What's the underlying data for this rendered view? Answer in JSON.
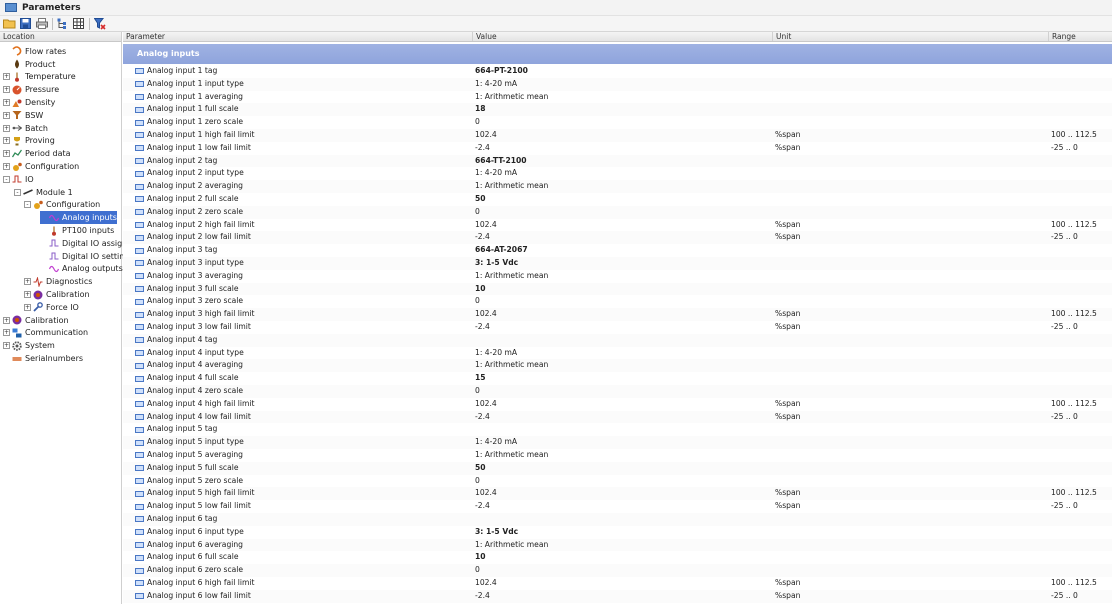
{
  "window": {
    "title": "Parameters"
  },
  "toolbar": {
    "buttons": [
      "open-folder-icon",
      "save-icon",
      "print-icon",
      "tree-view-icon",
      "grid-view-icon",
      "filter-icon"
    ]
  },
  "tree": {
    "header": "Location",
    "nodes": [
      {
        "label": "Flow rates",
        "level": 0,
        "icon": "flow-icon",
        "expander": ""
      },
      {
        "label": "Product",
        "level": 0,
        "icon": "drop-icon",
        "expander": ""
      },
      {
        "label": "Temperature",
        "level": 0,
        "icon": "thermometer-icon",
        "expander": "+"
      },
      {
        "label": "Pressure",
        "level": 0,
        "icon": "gauge-icon",
        "expander": "+"
      },
      {
        "label": "Density",
        "level": 0,
        "icon": "density-icon",
        "expander": "+"
      },
      {
        "label": "BSW",
        "level": 0,
        "icon": "funnel-icon",
        "expander": "+"
      },
      {
        "label": "Batch",
        "level": 0,
        "icon": "batch-icon",
        "expander": "+"
      },
      {
        "label": "Proving",
        "level": 0,
        "icon": "trophy-icon",
        "expander": "+"
      },
      {
        "label": "Period data",
        "level": 0,
        "icon": "period-icon",
        "expander": "+"
      },
      {
        "label": "Configuration",
        "level": 0,
        "icon": "config-icon",
        "expander": "+"
      },
      {
        "label": "IO",
        "level": 0,
        "icon": "io-icon",
        "expander": "-"
      },
      {
        "label": "Module 1",
        "level": 1,
        "icon": "module-icon",
        "expander": "-"
      },
      {
        "label": "Configuration",
        "level": 2,
        "icon": "config-icon",
        "expander": "-"
      },
      {
        "label": "Analog inputs",
        "level": 3,
        "icon": "wave-icon",
        "expander": "",
        "selected": true
      },
      {
        "label": "PT100 inputs",
        "level": 3,
        "icon": "thermometer-icon",
        "expander": ""
      },
      {
        "label": "Digital IO assign",
        "level": 3,
        "icon": "digital-icon",
        "expander": ""
      },
      {
        "label": "Digital IO settings",
        "level": 3,
        "icon": "digital-icon",
        "expander": ""
      },
      {
        "label": "Analog outputs",
        "level": 3,
        "icon": "wave-icon",
        "expander": ""
      },
      {
        "label": "Diagnostics",
        "level": 2,
        "icon": "diagnostics-icon",
        "expander": "+"
      },
      {
        "label": "Calibration",
        "level": 2,
        "icon": "calibration-icon",
        "expander": "+"
      },
      {
        "label": "Force IO",
        "level": 2,
        "icon": "wrench-icon",
        "expander": "+"
      },
      {
        "label": "Calibration",
        "level": 0,
        "icon": "calibration-icon",
        "expander": "+"
      },
      {
        "label": "Communication",
        "level": 0,
        "icon": "network-icon",
        "expander": "+"
      },
      {
        "label": "System",
        "level": 0,
        "icon": "gear-icon",
        "expander": "+"
      },
      {
        "label": "Serialnumbers",
        "level": 0,
        "icon": "serial-icon",
        "expander": ""
      }
    ]
  },
  "grid": {
    "columns": [
      "Parameter",
      "Value",
      "Unit",
      "Range"
    ],
    "group": "Analog inputs",
    "rows": [
      {
        "p": "Analog input 1 tag",
        "v": "664-PT-2100",
        "b": true,
        "u": "",
        "r": ""
      },
      {
        "p": "Analog input 1 input type",
        "v": "1: 4-20 mA",
        "b": false,
        "u": "",
        "r": ""
      },
      {
        "p": "Analog input 1 averaging",
        "v": "1: Arithmetic mean",
        "b": false,
        "u": "",
        "r": ""
      },
      {
        "p": "Analog input 1 full scale",
        "v": "18",
        "b": true,
        "u": "",
        "r": ""
      },
      {
        "p": "Analog input 1 zero scale",
        "v": "0",
        "b": false,
        "u": "",
        "r": ""
      },
      {
        "p": "Analog input 1 high fail limit",
        "v": "102.4",
        "b": false,
        "u": "%span",
        "r": "100 .. 112.5"
      },
      {
        "p": "Analog input 1 low fail limit",
        "v": "-2.4",
        "b": false,
        "u": "%span",
        "r": "-25 .. 0"
      },
      {
        "p": "Analog input 2 tag",
        "v": "664-TT-2100",
        "b": true,
        "u": "",
        "r": ""
      },
      {
        "p": "Analog input 2 input type",
        "v": "1: 4-20 mA",
        "b": false,
        "u": "",
        "r": ""
      },
      {
        "p": "Analog input 2 averaging",
        "v": "1: Arithmetic mean",
        "b": false,
        "u": "",
        "r": ""
      },
      {
        "p": "Analog input 2 full scale",
        "v": "50",
        "b": true,
        "u": "",
        "r": ""
      },
      {
        "p": "Analog input 2 zero scale",
        "v": "0",
        "b": false,
        "u": "",
        "r": ""
      },
      {
        "p": "Analog input 2 high fail limit",
        "v": "102.4",
        "b": false,
        "u": "%span",
        "r": "100 .. 112.5"
      },
      {
        "p": "Analog input 2 low fail limit",
        "v": "-2.4",
        "b": false,
        "u": "%span",
        "r": "-25 .. 0"
      },
      {
        "p": "Analog input 3 tag",
        "v": "664-AT-2067",
        "b": true,
        "u": "",
        "r": ""
      },
      {
        "p": "Analog input 3 input type",
        "v": "3: 1-5 Vdc",
        "b": true,
        "u": "",
        "r": ""
      },
      {
        "p": "Analog input 3 averaging",
        "v": "1: Arithmetic mean",
        "b": false,
        "u": "",
        "r": ""
      },
      {
        "p": "Analog input 3 full scale",
        "v": "10",
        "b": true,
        "u": "",
        "r": ""
      },
      {
        "p": "Analog input 3 zero scale",
        "v": "0",
        "b": false,
        "u": "",
        "r": ""
      },
      {
        "p": "Analog input 3 high fail limit",
        "v": "102.4",
        "b": false,
        "u": "%span",
        "r": "100 .. 112.5"
      },
      {
        "p": "Analog input 3 low fail limit",
        "v": "-2.4",
        "b": false,
        "u": "%span",
        "r": "-25 .. 0"
      },
      {
        "p": "Analog input 4 tag",
        "v": "",
        "b": false,
        "u": "",
        "r": ""
      },
      {
        "p": "Analog input 4 input type",
        "v": "1: 4-20 mA",
        "b": false,
        "u": "",
        "r": ""
      },
      {
        "p": "Analog input 4 averaging",
        "v": "1: Arithmetic mean",
        "b": false,
        "u": "",
        "r": ""
      },
      {
        "p": "Analog input 4 full scale",
        "v": "15",
        "b": true,
        "u": "",
        "r": ""
      },
      {
        "p": "Analog input 4 zero scale",
        "v": "0",
        "b": false,
        "u": "",
        "r": ""
      },
      {
        "p": "Analog input 4 high fail limit",
        "v": "102.4",
        "b": false,
        "u": "%span",
        "r": "100 .. 112.5"
      },
      {
        "p": "Analog input 4 low fail limit",
        "v": "-2.4",
        "b": false,
        "u": "%span",
        "r": "-25 .. 0"
      },
      {
        "p": "Analog input 5 tag",
        "v": "",
        "b": false,
        "u": "",
        "r": ""
      },
      {
        "p": "Analog input 5 input type",
        "v": "1: 4-20 mA",
        "b": false,
        "u": "",
        "r": ""
      },
      {
        "p": "Analog input 5 averaging",
        "v": "1: Arithmetic mean",
        "b": false,
        "u": "",
        "r": ""
      },
      {
        "p": "Analog input 5 full scale",
        "v": "50",
        "b": true,
        "u": "",
        "r": ""
      },
      {
        "p": "Analog input 5 zero scale",
        "v": "0",
        "b": false,
        "u": "",
        "r": ""
      },
      {
        "p": "Analog input 5 high fail limit",
        "v": "102.4",
        "b": false,
        "u": "%span",
        "r": "100 .. 112.5"
      },
      {
        "p": "Analog input 5 low fail limit",
        "v": "-2.4",
        "b": false,
        "u": "%span",
        "r": "-25 .. 0"
      },
      {
        "p": "Analog input 6 tag",
        "v": "",
        "b": false,
        "u": "",
        "r": ""
      },
      {
        "p": "Analog input 6 input type",
        "v": "3: 1-5 Vdc",
        "b": true,
        "u": "",
        "r": ""
      },
      {
        "p": "Analog input 6 averaging",
        "v": "1: Arithmetic mean",
        "b": false,
        "u": "",
        "r": ""
      },
      {
        "p": "Analog input 6 full scale",
        "v": "10",
        "b": true,
        "u": "",
        "r": ""
      },
      {
        "p": "Analog input 6 zero scale",
        "v": "0",
        "b": false,
        "u": "",
        "r": ""
      },
      {
        "p": "Analog input 6 high fail limit",
        "v": "102.4",
        "b": false,
        "u": "%span",
        "r": "100 .. 112.5"
      },
      {
        "p": "Analog input 6 low fail limit",
        "v": "-2.4",
        "b": false,
        "u": "%span",
        "r": "-25 .. 0"
      }
    ]
  },
  "colors": {
    "selection": "#3f6fd0",
    "group_header": "#9fb2e3"
  }
}
